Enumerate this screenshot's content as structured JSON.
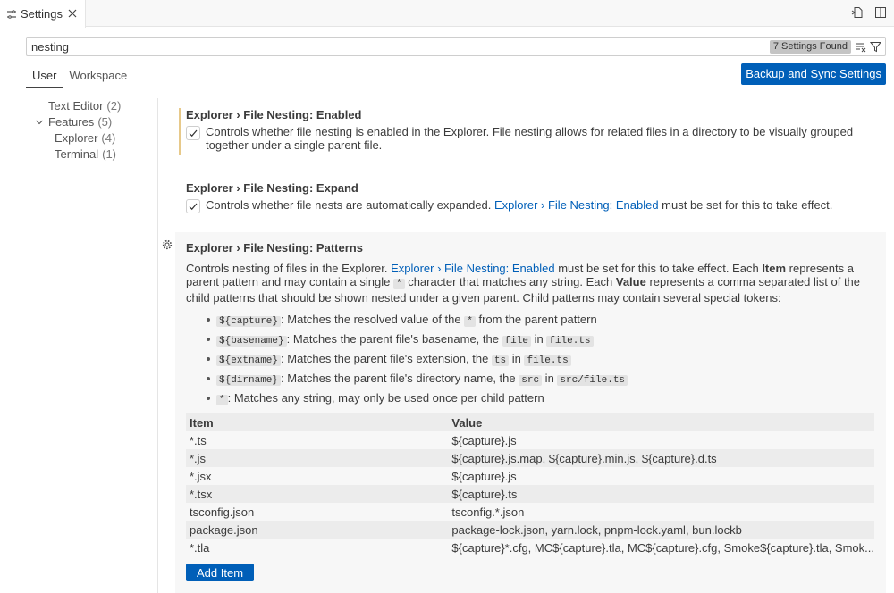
{
  "editor_tab": {
    "label": "Settings"
  },
  "search": {
    "value": "nesting",
    "result_count": "7 Settings Found"
  },
  "scope_tabs": [
    {
      "label": "User"
    },
    {
      "label": "Workspace"
    }
  ],
  "sync_button": "Backup and Sync Settings",
  "toc": [
    {
      "label": "Text Editor",
      "count": "(2)"
    },
    {
      "label": "Features",
      "count": "(5)"
    },
    {
      "label": "Explorer",
      "count": "(4)"
    },
    {
      "label": "Terminal",
      "count": "(1)"
    }
  ],
  "settings": {
    "enabled": {
      "category": "Explorer › File Nesting: ",
      "name": "Enabled",
      "desc": "Controls whether file nesting is enabled in the Explorer. File nesting allows for related files in a directory to be visually grouped together under a single parent file."
    },
    "expand": {
      "category": "Explorer › File Nesting: ",
      "name": "Expand",
      "desc_pre": "Controls whether file nests are automatically expanded. ",
      "link": "Explorer › File Nesting: Enabled",
      "desc_post": " must be set for this to take effect."
    },
    "patterns": {
      "category": "Explorer › File Nesting: ",
      "name": "Patterns",
      "d1": "Controls nesting of files in the Explorer. ",
      "link": "Explorer › File Nesting: Enabled",
      "d2": " must be set for this to take effect. Each ",
      "b1": "Item",
      "d3": " represents a parent pattern and may contain a single ",
      "c1": "*",
      "d4": " character that matches any string. Each ",
      "b2": "Value",
      "d5": " represents a comma separated list of the child patterns that should be shown nested under a given parent. Child patterns may contain several special tokens:",
      "tokens": [
        {
          "code": "${capture}",
          "t1": ": Matches the resolved value of the ",
          "c2": "*",
          "t2": " from the parent pattern",
          "t3": "",
          "c3": ""
        },
        {
          "code": "${basename}",
          "t1": ": Matches the parent file's basename, the ",
          "c2": "file",
          "t2": " in ",
          "c3": "file.ts",
          "t3": ""
        },
        {
          "code": "${extname}",
          "t1": ": Matches the parent file's extension, the ",
          "c2": "ts",
          "t2": " in ",
          "c3": "file.ts",
          "t3": ""
        },
        {
          "code": "${dirname}",
          "t1": ": Matches the parent file's directory name, the ",
          "c2": "src",
          "t2": " in ",
          "c3": "src/file.ts",
          "t3": ""
        },
        {
          "code": "*",
          "t1": ": Matches any string, may only be used once per child pattern",
          "c2": "",
          "t2": "",
          "c3": "",
          "t3": ""
        }
      ],
      "table_headers": {
        "item": "Item",
        "value": "Value"
      },
      "rows": [
        {
          "item": "*.ts",
          "value": "${capture}.js"
        },
        {
          "item": "*.js",
          "value": "${capture}.js.map, ${capture}.min.js, ${capture}.d.ts"
        },
        {
          "item": "*.jsx",
          "value": "${capture}.js"
        },
        {
          "item": "*.tsx",
          "value": "${capture}.ts"
        },
        {
          "item": "tsconfig.json",
          "value": "tsconfig.*.json"
        },
        {
          "item": "package.json",
          "value": "package-lock.json, yarn.lock, pnpm-lock.yaml, bun.lockb"
        },
        {
          "item": "*.tla",
          "value": "${capture}*.cfg, MC${capture}.tla, MC${capture}.cfg, Smoke${capture}.tla, Smok..."
        }
      ],
      "add_button": "Add Item"
    }
  },
  "colors": {
    "accent": "#005fb8",
    "modified": "#e7c98a",
    "panel": "#f7f7f7"
  }
}
